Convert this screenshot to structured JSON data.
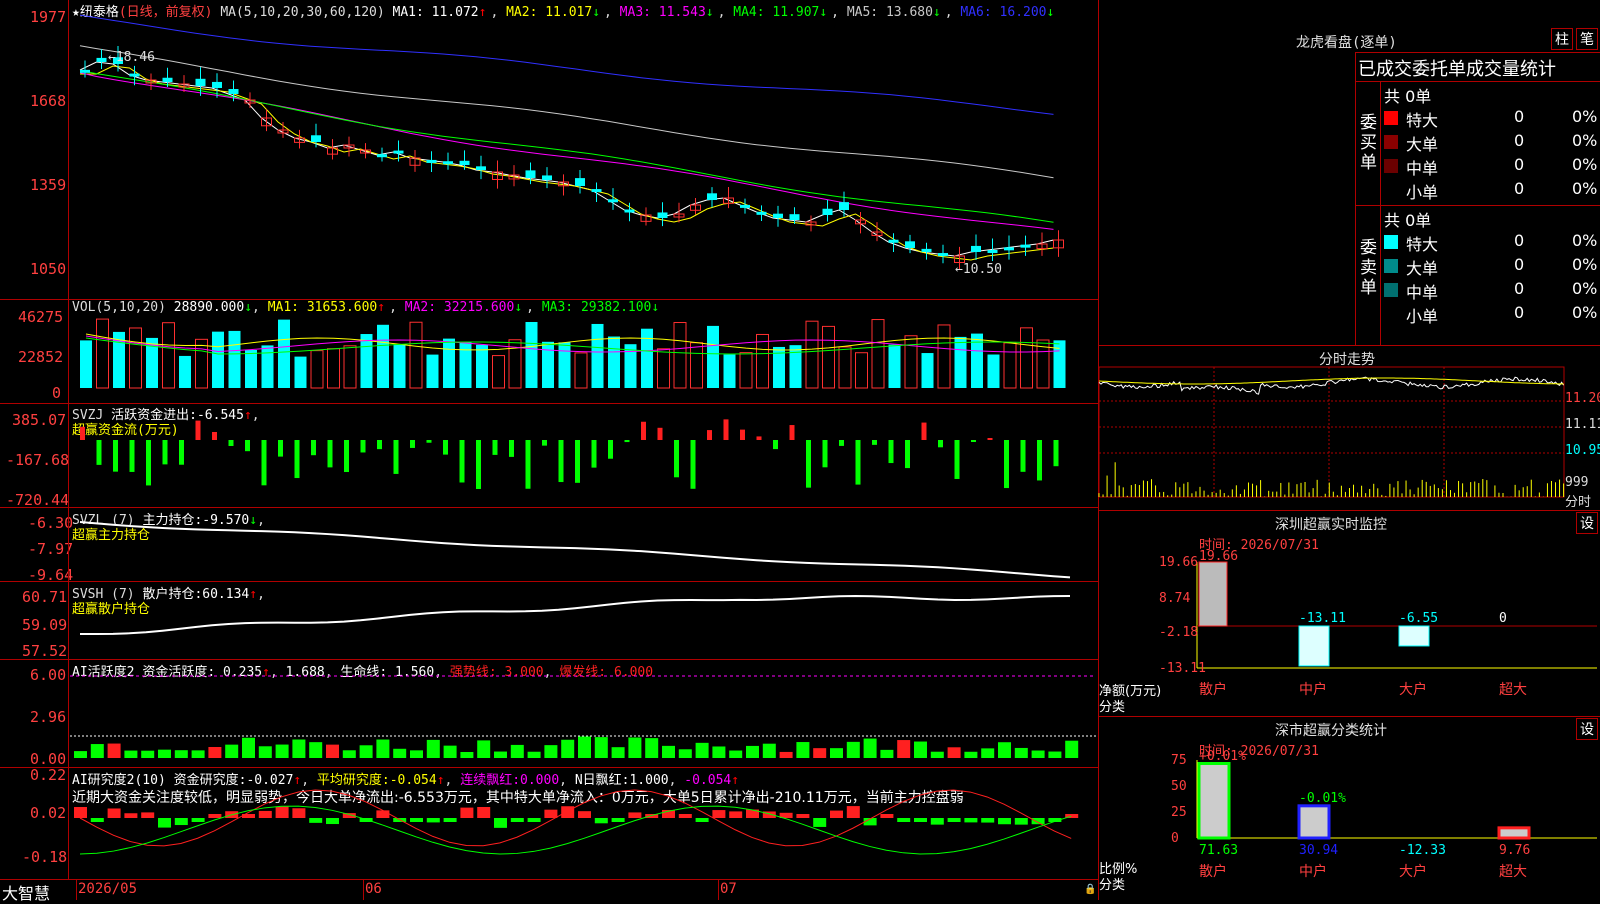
{
  "app": {
    "name": "大智慧"
  },
  "stock": {
    "title": "★纽泰格",
    "period": "(日线，前复权)"
  },
  "main_chart": {
    "ma_header": "MA(5,10,20,30,60,120)",
    "ma": [
      {
        "label": "MA1:",
        "value": "11.072",
        "arrow": "↑",
        "color": "#ffffff"
      },
      {
        "label": "MA2:",
        "value": "11.017",
        "arrow": "↓",
        "color": "#ffff00"
      },
      {
        "label": "MA3:",
        "value": "11.543",
        "arrow": "↓",
        "color": "#ff00ff"
      },
      {
        "label": "MA4:",
        "value": "11.907",
        "arrow": "↓",
        "color": "#00ff00"
      },
      {
        "label": "MA5:",
        "value": "13.680",
        "arrow": "↓",
        "color": "#c8c8c8"
      },
      {
        "label": "MA6:",
        "value": "16.200",
        "arrow": "↓",
        "color": "#3030ff"
      }
    ],
    "y_labels": [
      "1977",
      "1668",
      "1359",
      "1050"
    ],
    "high_label": "18.46",
    "low_label": "10.50"
  },
  "vol": {
    "title": "VOL(5,10,20)",
    "value": "28890.000",
    "arrow": "↓",
    "ma": [
      {
        "label": "MA1:",
        "value": "31653.600",
        "arrow": "↑",
        "color": "#ffff00"
      },
      {
        "label": "MA2:",
        "value": "32215.600",
        "arrow": "↓",
        "color": "#ff00ff"
      },
      {
        "label": "MA3:",
        "value": "29382.100",
        "arrow": "↓",
        "color": "#00ff00"
      }
    ],
    "y_labels": [
      "46275",
      "22852",
      "0"
    ]
  },
  "svzj": {
    "title": "SVZJ",
    "name": "活跃资金进出:",
    "value": "-6.545",
    "arrow": "↑",
    "line2": "超赢资金流(万元)",
    "y_labels": [
      "385.07",
      "-167.68",
      "-720.44"
    ]
  },
  "svzl": {
    "title": "SVZL (7)",
    "name": "主力持仓:",
    "value": "-9.570",
    "arrow": "↓",
    "line2": "超赢主力持仓",
    "y_labels": [
      "-6.30",
      "-7.97",
      "-9.64"
    ]
  },
  "svsh": {
    "title": "SVSH (7)",
    "name": "散户持仓:",
    "value": "60.134",
    "arrow": "↑",
    "line2": "超赢散户持仓",
    "y_labels": [
      "60.71",
      "59.09",
      "57.52"
    ]
  },
  "ai2": {
    "title": "AI活跃度2",
    "name": "资金活跃度:",
    "v1": "0.235",
    "a1": "↑",
    "v2": "1.688",
    "name2": "生命线:",
    "v3": "1.560",
    "strong": "强势线: 3.000",
    "burst": "爆发线: 6.000",
    "y_labels": [
      "6.00",
      "2.96",
      "0.00"
    ]
  },
  "ai3": {
    "title": "AI研究度2(10)",
    "name": "资金研究度:",
    "v1": "-0.027",
    "a1": "↑",
    "name2": "平均研究度:",
    "v2": "-0.054",
    "a2": "↑",
    "name3": "连续飘红:",
    "v3": "0.000",
    "name4": "N日飘红:",
    "v4": "1.000",
    "v5": "-0.054",
    "a5": "↑",
    "comment": "近期大资金关注度较低，明显弱势，今日大单净流出:-6.553万元，其中特大单净流入：0万元，大单5日累计净出-210.11万元，当前主力控盘弱",
    "y_labels": [
      "0.22",
      "0.02",
      "-0.18"
    ]
  },
  "x_axis": [
    "2026/05",
    "06",
    "07"
  ],
  "right": {
    "lhb": {
      "title": "龙虎看盘(逐单)",
      "btn1": "柱",
      "btn2": "笔",
      "subtitle": "已成交委托单成交量统计",
      "buy_label": "委买单",
      "sell_label": "委卖单",
      "count_buy": "共 0单",
      "count_sell": "共 0单",
      "buy_rows": [
        {
          "name": "特大",
          "v": "0",
          "p": "0%",
          "color": "#ff0000"
        },
        {
          "name": "大单",
          "v": "0",
          "p": "0%",
          "color": "#8b0000"
        },
        {
          "name": "中单",
          "v": "0",
          "p": "0%",
          "color": "#6b0000"
        },
        {
          "name": "小单",
          "v": "0",
          "p": "0%",
          "color": "#000000"
        }
      ],
      "sell_rows": [
        {
          "name": "特大",
          "v": "0",
          "p": "0%",
          "color": "#00ffff"
        },
        {
          "name": "大单",
          "v": "0",
          "p": "0%",
          "color": "#008b8b"
        },
        {
          "name": "中单",
          "v": "0",
          "p": "0%",
          "color": "#007070"
        },
        {
          "name": "小单",
          "v": "0",
          "p": "0%",
          "color": "#000000"
        }
      ]
    },
    "intraday": {
      "title": "分时走势",
      "y_labels": [
        "11.20",
        "11.11",
        "10.95"
      ],
      "vol_label": "999",
      "footer": "分时"
    },
    "monitor": {
      "title": "深圳超赢实时监控",
      "btn": "设",
      "time": "时间: 2026/07/31",
      "y_labels": [
        "19.66",
        "8.74",
        "-2.18",
        "-13.11"
      ],
      "bars": [
        {
          "cat": "散户",
          "value": "19.66"
        },
        {
          "cat": "中户",
          "value": "-13.11"
        },
        {
          "cat": "大户",
          "value": "-6.55"
        },
        {
          "cat": "超大",
          "value": "0"
        }
      ],
      "ylabel": "净额(万元)",
      "xlabel": "分类"
    },
    "classify": {
      "title": "深市超赢分类统计",
      "btn": "设",
      "time": "时间: 2026/07/31",
      "y_labels": [
        "75",
        "50",
        "25",
        "0"
      ],
      "top": [
        {
          "cat": "散户",
          "label": "+0.01%"
        },
        {
          "cat": "中户",
          "label": "-0.01%"
        }
      ],
      "bottom": [
        {
          "cat": "散户",
          "value": "71.63"
        },
        {
          "cat": "中户",
          "value": "30.94"
        },
        {
          "cat": "大户",
          "value": "-12.33"
        },
        {
          "cat": "超大",
          "value": "9.76"
        }
      ],
      "ylabel": "比例%",
      "xlabel": "分类"
    }
  }
}
